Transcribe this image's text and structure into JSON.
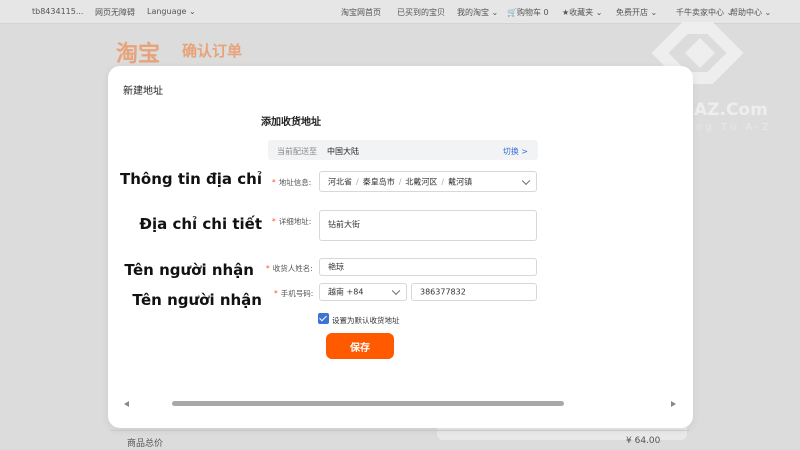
{
  "topbar": {
    "account": "tb8434115...",
    "accessibility": "网页无障碍",
    "language": "Language",
    "home": "淘宝网首页",
    "bought": "已买到的宝贝",
    "my_taobao": "我的淘宝",
    "cart": "购物车 0",
    "favorites": "收藏夹",
    "open_shop": "免费开店",
    "seller_center": "千牛卖家中心",
    "help": "帮助中心"
  },
  "page": {
    "logo": "淘宝",
    "heading": "确认订单",
    "bottom_left": "商品总价",
    "bottom_right": "¥ 64.00"
  },
  "watermark": {
    "text": "AZ.Com",
    "sub": "ng Từ A-Z"
  },
  "modal": {
    "title": "新建地址",
    "form_title": "添加收货地址",
    "region": {
      "label": "当前配送至",
      "value": "中国大陆",
      "switch": "切换 >"
    },
    "address_info": {
      "label": "地址信息:",
      "province": "河北省",
      "city": "秦皇岛市",
      "district": "北戴河区",
      "town": "戴河镇"
    },
    "detail": {
      "label": "详细地址:",
      "value": "钻前大街"
    },
    "recipient": {
      "label": "收货人姓名:",
      "value": "艳琼"
    },
    "phone": {
      "label": "手机号码:",
      "country": "越南 +84",
      "value": "386377832"
    },
    "default_label": "设置为默认收货地址",
    "save_label": "保存"
  },
  "annotations": {
    "address_info": "Thông tin địa chỉ",
    "detail_address": "Địa chỉ chi tiết",
    "recipient_name": "Tên người nhận",
    "recipient_phone": "Tên người nhận"
  }
}
